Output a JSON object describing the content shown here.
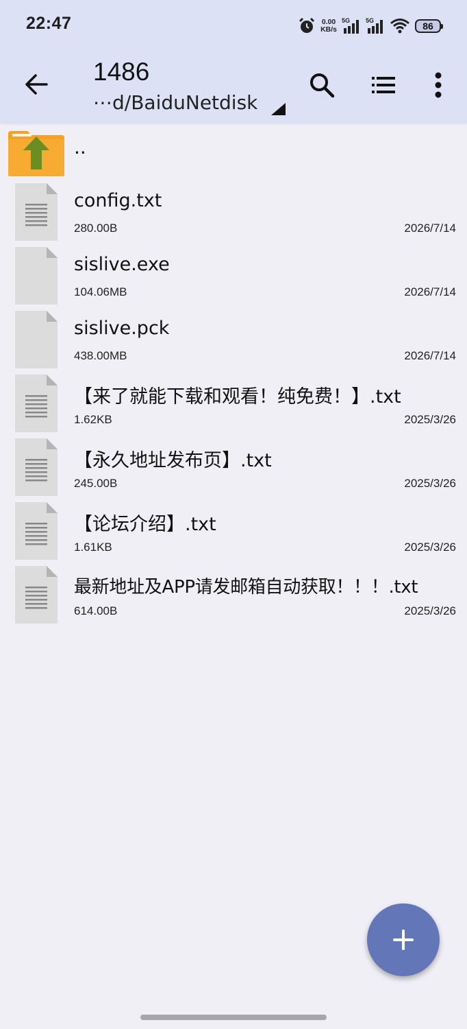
{
  "status_bar": {
    "time": "22:47",
    "net_speed_value": "0.00",
    "net_speed_unit": "KB/s",
    "sim1_label": "5G",
    "sim2_label": "5G",
    "battery": "86"
  },
  "toolbar": {
    "title": "1486",
    "path": "⋯d/BaiduNetdisk"
  },
  "parent_dir_label": "..",
  "files": [
    {
      "name": "config.txt",
      "size": "280.00B",
      "date": "2026/7/14",
      "icon": "text-file-icon"
    },
    {
      "name": "sislive.exe",
      "size": "104.06MB",
      "date": "2026/7/14",
      "icon": "blank-file-icon"
    },
    {
      "name": "sislive.pck",
      "size": "438.00MB",
      "date": "2026/7/14",
      "icon": "blank-file-icon"
    },
    {
      "name": "【来了就能下载和观看！纯免费！】.txt",
      "size": "1.62KB",
      "date": "2025/3/26",
      "icon": "text-file-icon"
    },
    {
      "name": "【永久地址发布页】.txt",
      "size": "245.00B",
      "date": "2025/3/26",
      "icon": "text-file-icon"
    },
    {
      "name": "【论坛介绍】.txt",
      "size": "1.61KB",
      "date": "2025/3/26",
      "icon": "text-file-icon"
    },
    {
      "name": "最新地址及APP请发邮箱自动获取！！！.txt",
      "size": "614.00B",
      "date": "2025/3/26",
      "icon": "text-file-icon"
    }
  ],
  "colors": {
    "header_bg": "#dde1f5",
    "list_bg": "#f1eff6",
    "fab_bg": "#6276b8",
    "folder_orange": "#f5a127",
    "folder_arrow_green": "#6b8e23"
  }
}
